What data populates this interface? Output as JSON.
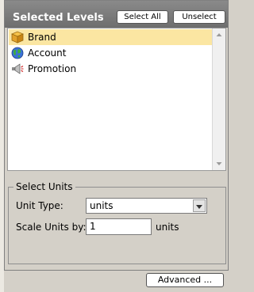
{
  "header": {
    "title": "Selected Levels",
    "select_all_label": "Select All",
    "unselect_label": "Unselect"
  },
  "levels": {
    "items": [
      {
        "label": "Brand",
        "icon": "brand-box-icon",
        "selected": true
      },
      {
        "label": "Account",
        "icon": "globe-icon",
        "selected": false
      },
      {
        "label": "Promotion",
        "icon": "megaphone-icon",
        "selected": false
      }
    ]
  },
  "units": {
    "group_label": "Select Units",
    "unit_type_label": "Unit Type:",
    "unit_type_value": "units",
    "scale_label": "Scale Units by:",
    "scale_value": "1",
    "scale_suffix": "units"
  },
  "footer": {
    "advanced_label": "Advanced ..."
  },
  "colors": {
    "header_bg": "#7c7c7c",
    "selection": "#fbe6a2",
    "panel_bg": "#d4d0c8"
  }
}
